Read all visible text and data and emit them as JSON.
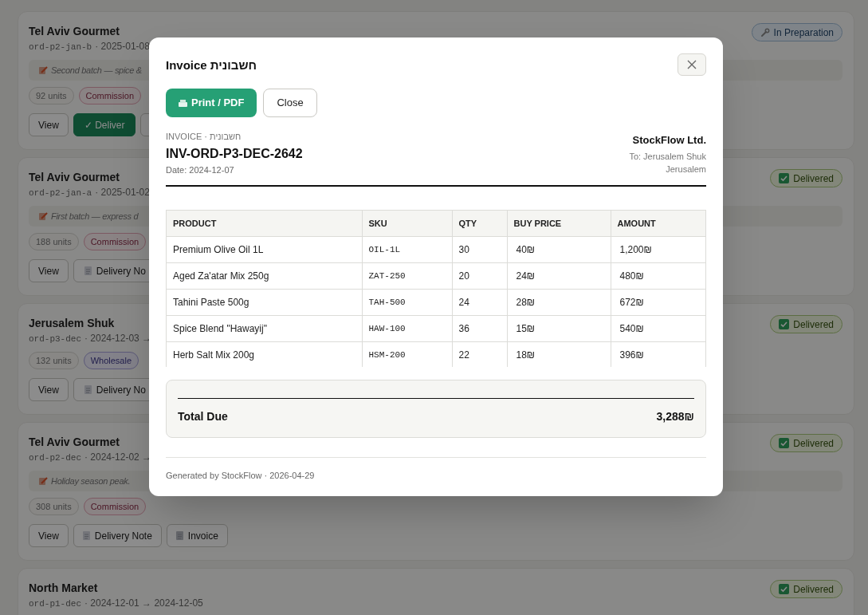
{
  "cards": [
    {
      "title": "Tel Aviv Gourmet",
      "order_id": "ord-p2-jan-b",
      "dates": "· 2025-01-08",
      "status": {
        "label": "In Preparation",
        "kind": "preparation"
      },
      "note": "Second batch — spice &",
      "badges": [
        {
          "label": "92 units",
          "kind": "units"
        },
        {
          "label": "Commission",
          "kind": "commission"
        }
      ],
      "buttons": [
        {
          "label": "View",
          "kind": "plain"
        },
        {
          "label": "✓ Deliver",
          "kind": "primary"
        },
        {
          "kind": "partial"
        }
      ]
    },
    {
      "title": "Tel Aviv Gourmet",
      "order_id": "ord-p2-jan-a",
      "dates": "· 2025-01-02",
      "status": {
        "label": "Delivered",
        "kind": "delivered"
      },
      "note": "First batch — express d",
      "badges": [
        {
          "label": "188 units",
          "kind": "units"
        },
        {
          "label": "Commission",
          "kind": "commission"
        }
      ],
      "buttons": [
        {
          "label": "View",
          "kind": "plain"
        },
        {
          "label": "Delivery No",
          "kind": "delivery"
        }
      ]
    },
    {
      "title": "Jerusalem Shuk",
      "order_id": "ord-p3-dec",
      "dates": "· 2024-12-03 →",
      "status": {
        "label": "Delivered",
        "kind": "delivered"
      },
      "badges": [
        {
          "label": "132 units",
          "kind": "units"
        },
        {
          "label": "Wholesale",
          "kind": "wholesale"
        }
      ],
      "buttons": [
        {
          "label": "View",
          "kind": "plain"
        },
        {
          "label": "Delivery No",
          "kind": "delivery"
        }
      ]
    },
    {
      "title": "Tel Aviv Gourmet",
      "order_id": "ord-p2-dec",
      "dates": "· 2024-12-02 →",
      "status": {
        "label": "Delivered",
        "kind": "delivered"
      },
      "note": "Holiday season peak.",
      "badges": [
        {
          "label": "308 units",
          "kind": "units"
        },
        {
          "label": "Commission",
          "kind": "commission"
        }
      ],
      "buttons": [
        {
          "label": "View",
          "kind": "plain"
        },
        {
          "label": "Delivery Note",
          "kind": "delivery"
        },
        {
          "label": "Invoice",
          "kind": "invoice"
        }
      ]
    },
    {
      "title": "North Market",
      "order_id": "ord-p1-dec",
      "dates": "· 2024-12-01 → 2024-12-05",
      "status": {
        "label": "Delivered",
        "kind": "delivered"
      }
    }
  ],
  "modal": {
    "title": "Invoice חשבונית",
    "print_button": "Print / PDF",
    "close_button": "Close",
    "doc_label": "INVOICE · חשבונית",
    "invoice_number": "INV-ORD-P3-DEC-2642",
    "date": "Date: 2024-12-07",
    "company": "StockFlow Ltd.",
    "to": "To: Jerusalem Shuk",
    "city": "Jerusalem",
    "table": {
      "columns": [
        "PRODUCT",
        "SKU",
        "QTY",
        "BUY PRICE",
        "AMOUNT"
      ],
      "rows": [
        [
          "Premium Olive Oil 1L",
          "OIL-1L",
          "30",
          "40₪",
          "1,200₪"
        ],
        [
          "Aged Za'atar Mix 250g",
          "ZAT-250",
          "20",
          "24₪",
          "480₪"
        ],
        [
          "Tahini Paste 500g",
          "TAH-500",
          "24",
          "28₪",
          "672₪"
        ],
        [
          "Spice Blend \"Hawayij\"",
          "HAW-100",
          "36",
          "15₪",
          "540₪"
        ],
        [
          "Herb Salt Mix 200g",
          "HSM-200",
          "22",
          "18₪",
          "396₪"
        ]
      ]
    },
    "total_label": "Total Due",
    "total_value": "3,288₪",
    "footer": "Generated by StockFlow · 2026-04-29"
  }
}
